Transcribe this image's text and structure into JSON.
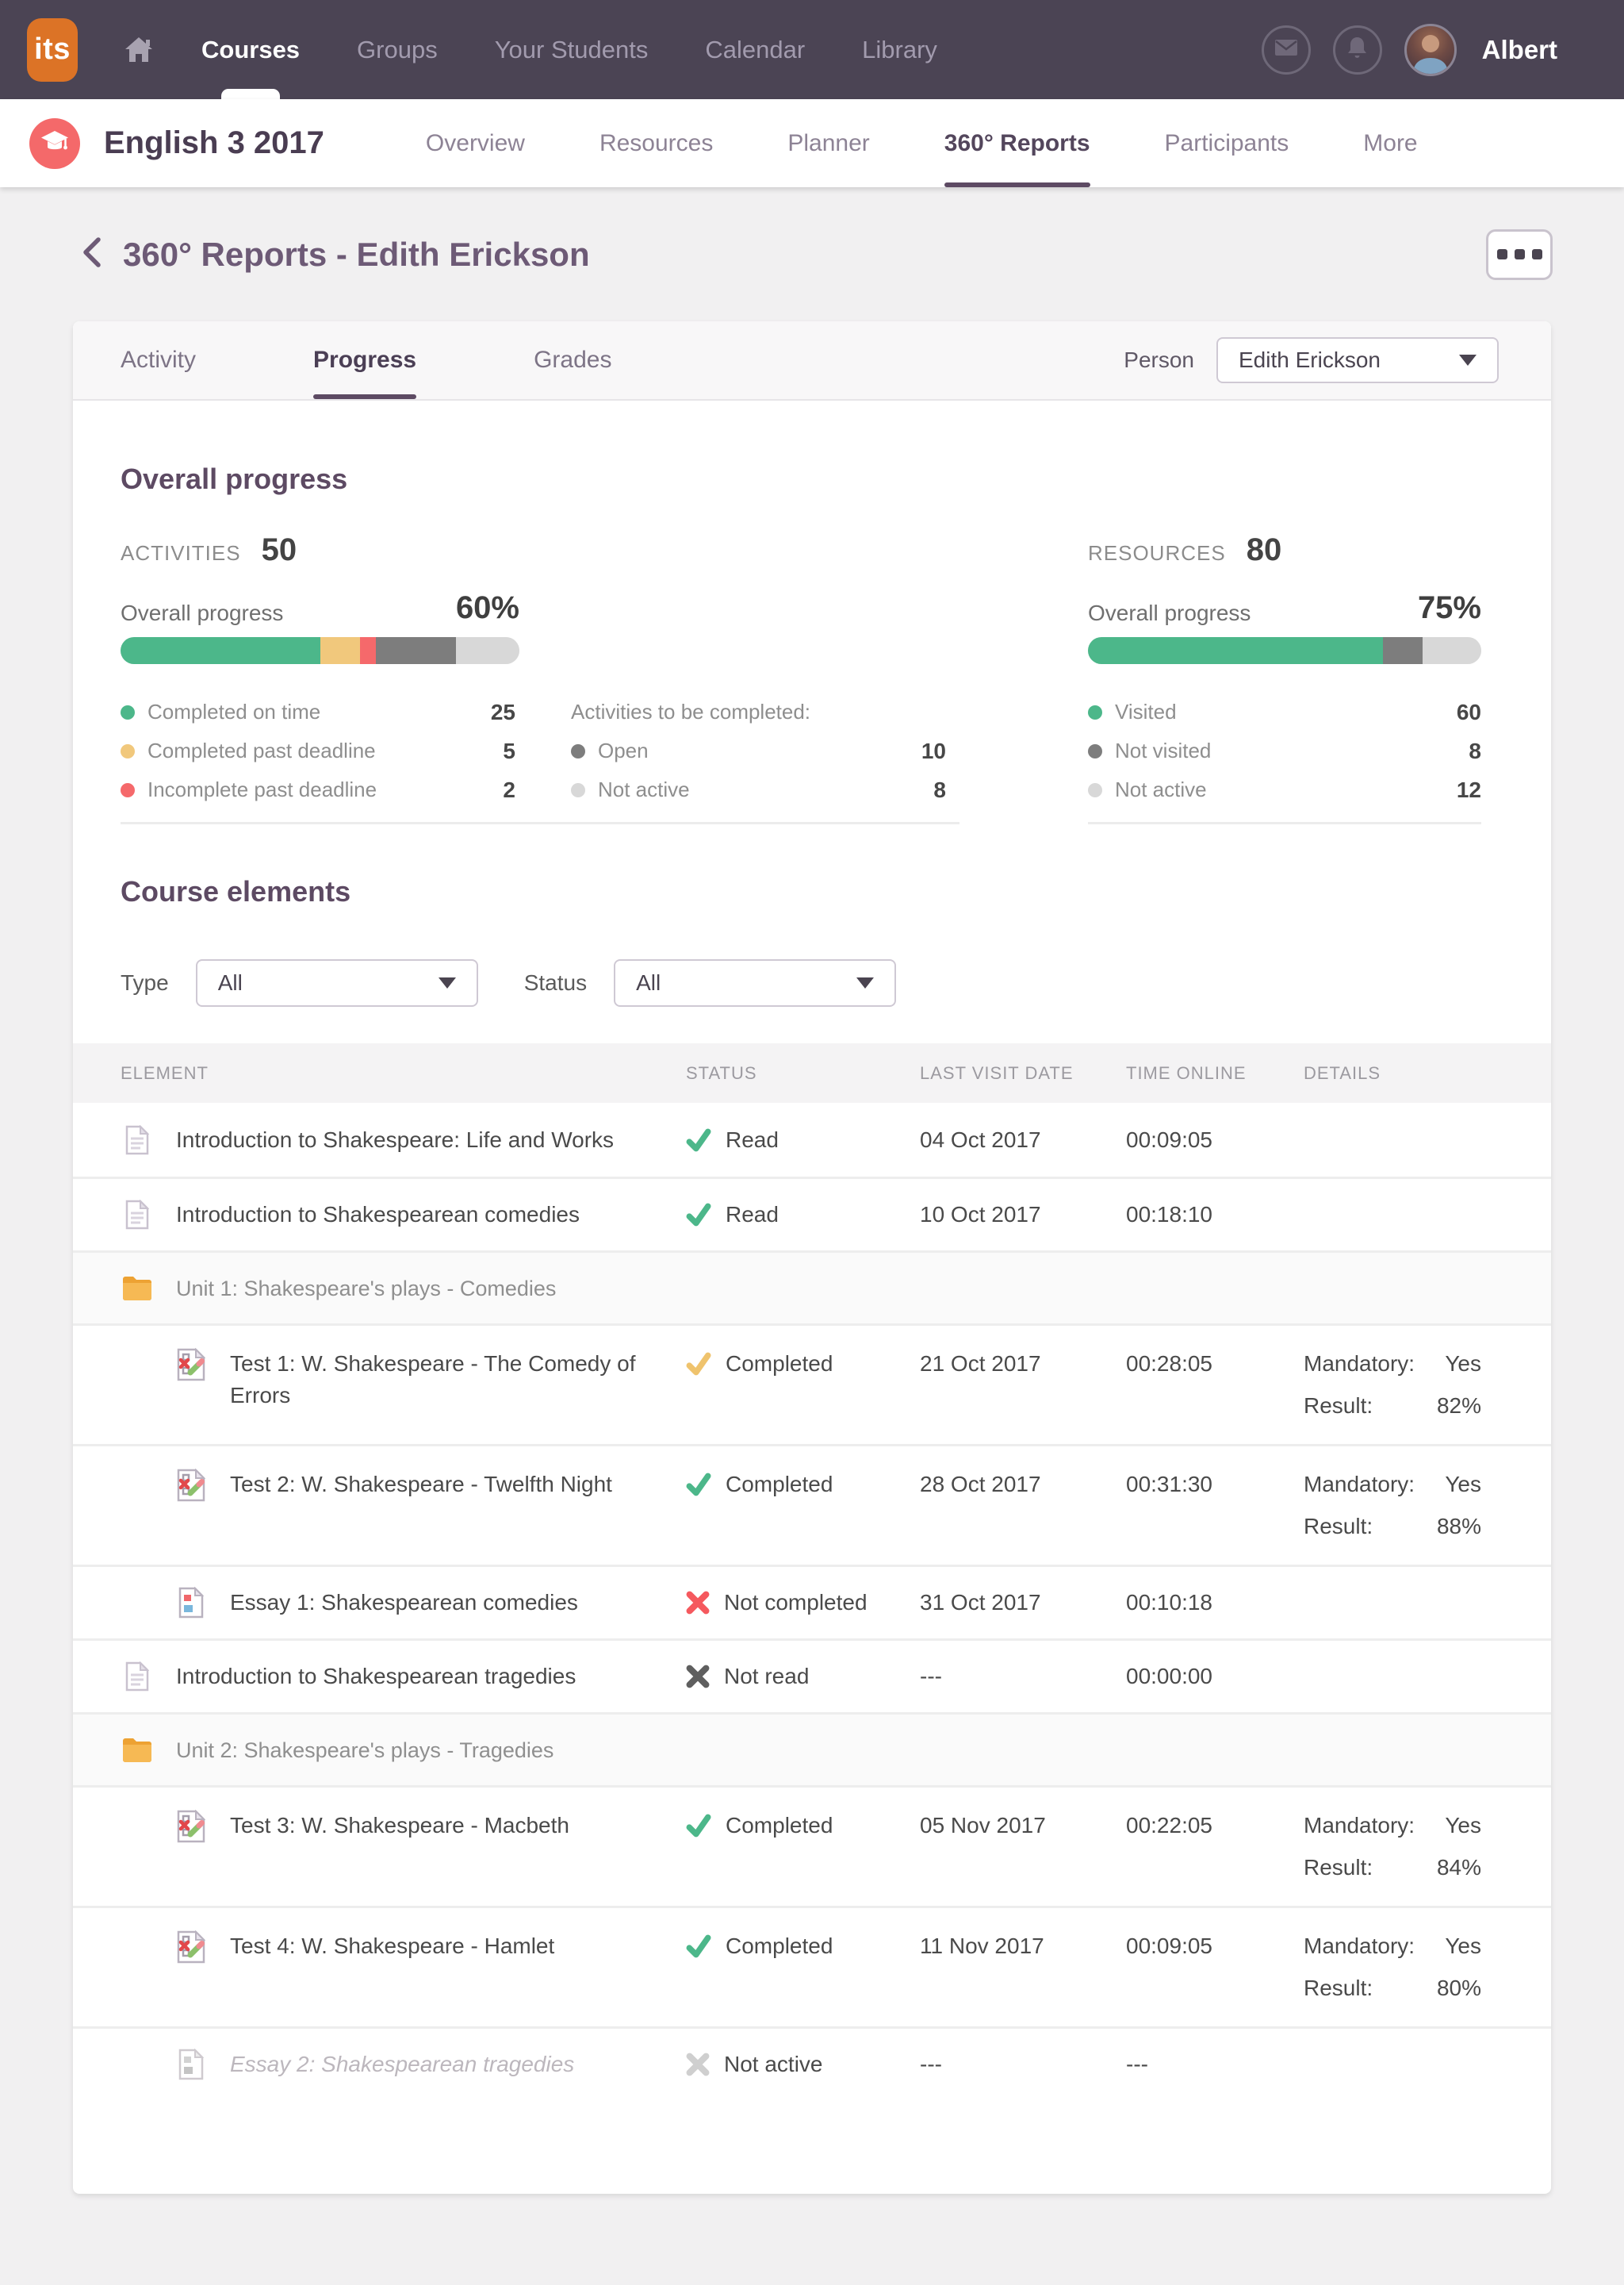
{
  "topnav": {
    "logo": "its",
    "items": [
      {
        "label": "Courses"
      },
      {
        "label": "Groups"
      },
      {
        "label": "Your Students"
      },
      {
        "label": "Calendar"
      },
      {
        "label": "Library"
      }
    ],
    "user_name": "Albert"
  },
  "coursenav": {
    "title": "English 3 2017",
    "items": [
      {
        "label": "Overview"
      },
      {
        "label": "Resources"
      },
      {
        "label": "Planner"
      },
      {
        "label": "360° Reports"
      },
      {
        "label": "Participants"
      },
      {
        "label": "More"
      }
    ]
  },
  "page": {
    "title": "360° Reports - Edith Erickson"
  },
  "tabs": {
    "items": [
      {
        "label": "Activity"
      },
      {
        "label": "Progress"
      },
      {
        "label": "Grades"
      }
    ],
    "person_label": "Person",
    "person_value": "Edith Erickson"
  },
  "overall": {
    "heading": "Overall progress",
    "activities": {
      "label": "ACTIVITIES",
      "count": "50",
      "progress_label": "Overall progress",
      "progress_pct": "60%",
      "segments": [
        {
          "name": "completed-on-time",
          "color": "#4cb78a",
          "pct": 50
        },
        {
          "name": "completed-past-deadline",
          "color": "#f1c87c",
          "pct": 10
        },
        {
          "name": "incomplete-past-deadline",
          "color": "#f5696b",
          "pct": 4
        },
        {
          "name": "open",
          "color": "#7d7d7d",
          "pct": 20
        },
        {
          "name": "not-active",
          "color": "#d8d8d8",
          "pct": 16
        }
      ],
      "legend": [
        {
          "label": "Completed on time",
          "value": "25"
        },
        {
          "label": "Completed past deadline",
          "value": "5"
        },
        {
          "label": "Incomplete past deadline",
          "value": "2"
        }
      ],
      "to_complete_title": "Activities to be completed:",
      "to_complete": [
        {
          "label": "Open",
          "value": "10"
        },
        {
          "label": "Not active",
          "value": "8"
        }
      ]
    },
    "resources": {
      "label": "RESOURCES",
      "count": "80",
      "progress_label": "Overall progress",
      "progress_pct": "75%",
      "segments": [
        {
          "name": "visited",
          "color": "#4cb78a",
          "pct": 75
        },
        {
          "name": "not-visited",
          "color": "#7d7d7d",
          "pct": 10
        },
        {
          "name": "not-active",
          "color": "#d8d8d8",
          "pct": 15
        }
      ],
      "legend": [
        {
          "label": "Visited",
          "value": "60"
        },
        {
          "label": "Not visited",
          "value": "8"
        },
        {
          "label": "Not active",
          "value": "12"
        }
      ]
    }
  },
  "course_elements": {
    "heading": "Course elements",
    "type_label": "Type",
    "type_value": "All",
    "status_label": "Status",
    "status_value": "All"
  },
  "table": {
    "headers": {
      "element": "ELEMENT",
      "status": "STATUS",
      "last_visit": "LAST VISIT DATE",
      "time_online": "TIME ONLINE",
      "details": "DETAILS"
    },
    "rows": [
      {
        "name": "Introduction to Shakespeare: Life and Works",
        "status": "Read",
        "date": "04 Oct 2017",
        "time": "00:09:05"
      },
      {
        "name": "Introduction to Shakespearean comedies",
        "status": "Read",
        "date": "10 Oct 2017",
        "time": "00:18:10"
      },
      {
        "name": "Unit 1: Shakespeare's plays - Comedies"
      },
      {
        "name": "Test 1: W. Shakespeare - The Comedy of Errors",
        "status": "Completed",
        "date": "21 Oct 2017",
        "time": "00:28:05",
        "mandatory_label": "Mandatory:",
        "mandatory_value": "Yes",
        "result_label": "Result:",
        "result_value": "82%"
      },
      {
        "name": "Test 2: W. Shakespeare - Twelfth Night",
        "status": "Completed",
        "date": "28 Oct 2017",
        "time": "00:31:30",
        "mandatory_label": "Mandatory:",
        "mandatory_value": "Yes",
        "result_label": "Result:",
        "result_value": "88%"
      },
      {
        "name": "Essay 1: Shakespearean comedies",
        "status": "Not completed",
        "date": "31 Oct 2017",
        "time": "00:10:18"
      },
      {
        "name": "Introduction to Shakespearean tragedies",
        "status": "Not read",
        "date": "---",
        "time": "00:00:00"
      },
      {
        "name": "Unit 2: Shakespeare's plays - Tragedies"
      },
      {
        "name": "Test 3: W. Shakespeare - Macbeth",
        "status": "Completed",
        "date": "05 Nov 2017",
        "time": "00:22:05",
        "mandatory_label": "Mandatory:",
        "mandatory_value": "Yes",
        "result_label": "Result:",
        "result_value": "84%"
      },
      {
        "name": "Test 4: W. Shakespeare - Hamlet",
        "status": "Completed",
        "date": "11 Nov 2017",
        "time": "00:09:05",
        "mandatory_label": "Mandatory:",
        "mandatory_value": "Yes",
        "result_label": "Result:",
        "result_value": "80%"
      },
      {
        "name": "Essay 2: Shakespearean tragedies",
        "status": "Not active",
        "date": "---",
        "time": "---"
      }
    ]
  }
}
